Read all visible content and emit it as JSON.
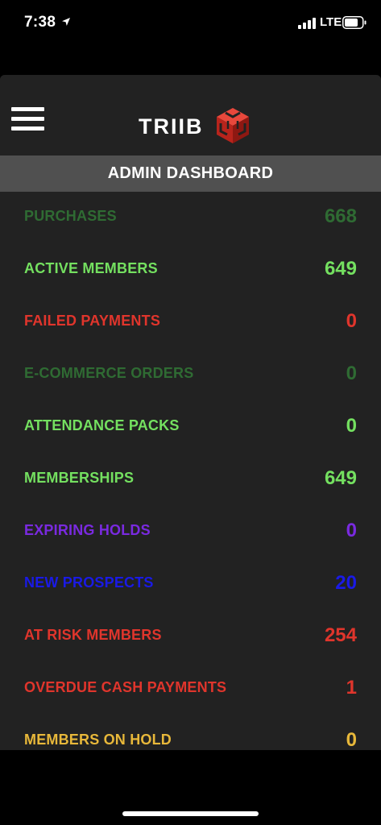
{
  "status_bar": {
    "time": "7:38",
    "network": "LTE"
  },
  "header": {
    "logo_text": "TRIIB",
    "menu_icon": "hamburger-menu-icon",
    "logo_icon": "cube-logo-icon",
    "logo_accent": "#e03a2f"
  },
  "dashboard": {
    "title": "ADMIN DASHBOARD",
    "stats": [
      {
        "label": "PURCHASES",
        "value": "668",
        "color": "#2f6b33"
      },
      {
        "label": "ACTIVE MEMBERS",
        "value": "649",
        "color": "#74e060"
      },
      {
        "label": "FAILED PAYMENTS",
        "value": "0",
        "color": "#e0352c"
      },
      {
        "label": "E-COMMERCE ORDERS",
        "value": "0",
        "color": "#2f6b33"
      },
      {
        "label": "ATTENDANCE PACKS",
        "value": "0",
        "color": "#74e060"
      },
      {
        "label": "MEMBERSHIPS",
        "value": "649",
        "color": "#74e060"
      },
      {
        "label": "EXPIRING HOLDS",
        "value": "0",
        "color": "#7a2ae0"
      },
      {
        "label": "NEW PROSPECTS",
        "value": "20",
        "color": "#1a1ae6"
      },
      {
        "label": "AT RISK MEMBERS",
        "value": "254",
        "color": "#e0352c"
      },
      {
        "label": "OVERDUE CASH PAYMENTS",
        "value": "1",
        "color": "#e0352c"
      },
      {
        "label": "MEMBERS ON HOLD",
        "value": "0",
        "color": "#e8b83a"
      }
    ]
  }
}
